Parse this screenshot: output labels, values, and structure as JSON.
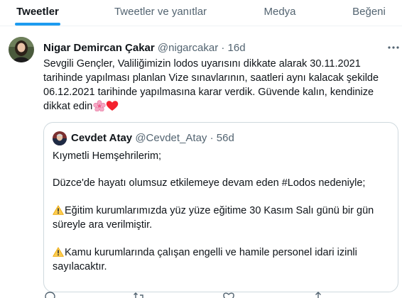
{
  "tabs": [
    {
      "label": "Tweetler",
      "active": true
    },
    {
      "label": "Tweetler ve yanıtlar",
      "active": false
    },
    {
      "label": "Medya",
      "active": false
    },
    {
      "label": "Beğeni",
      "active": false
    }
  ],
  "tweet": {
    "author_name": "Nigar Demircan Çakar",
    "handle": "@nigarcakar",
    "separator": "·",
    "time": "16d",
    "text_lines": [
      "Sevgili Gençler, Valiliğimizin lodos uyarısını dikkate alarak 30.11.2021",
      "tarihinde yapılması planlan Vize sınavlarının, saatleri aynı kalacak şekilde",
      "06.12.2021 tarihinde yapılmasına karar verdik. Güvende kalın, kendinize",
      "dikkat edin"
    ],
    "emoji_icons": [
      "cherry-blossom-icon",
      "red-heart-icon"
    ]
  },
  "quote": {
    "author_name": "Cevdet Atay",
    "handle": "@Cevdet_Atay",
    "separator": "·",
    "time": "56d",
    "lines": [
      "Kıymetli Hemşehrilerim;",
      "Düzce'de hayatı olumsuz etkilemeye devam eden #Lodos nedeniyle;",
      "Eğitim kurumlarımızda yüz yüze eğitime 30 Kasım Salı günü bir gün",
      "süreyle ara verilmiştir.",
      "Kamu kurumlarında çalışan engelli ve hamile personel idari izinli",
      "sayılacaktır."
    ]
  },
  "colors": {
    "accent": "#1d9bf0",
    "secondary_text": "#536471",
    "border": "#cfd9de",
    "heart": "#f4212e",
    "warning": "#ffcc4d"
  }
}
